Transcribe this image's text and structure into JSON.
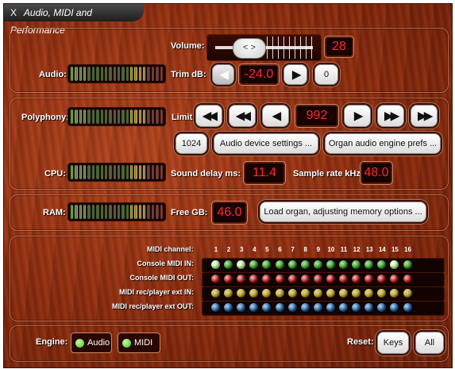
{
  "window": {
    "close_glyph": "X",
    "title": "Audio, MIDI and Performance"
  },
  "audio": {
    "label": "Audio:",
    "volume_label": "Volume:",
    "volume_value": "28",
    "volume_knob_glyph": "< >",
    "trim_label": "Trim dB:",
    "trim_value": "-24.0",
    "trim_reset": "0"
  },
  "polyphony": {
    "label": "Polyphony:",
    "limit_label": "Limit:",
    "limit_value": "992",
    "preset_button": "1024",
    "device_settings_button": "Audio device settings ...",
    "engine_prefs_button": "Organ audio engine prefs ..."
  },
  "cpu": {
    "label": "CPU:",
    "sound_delay_label": "Sound delay ms:",
    "sound_delay_value": "11.4",
    "sample_rate_label": "Sample rate kHz:",
    "sample_rate_value": "48.0"
  },
  "ram": {
    "label": "RAM:",
    "free_label": "Free GB:",
    "free_value": "46.0",
    "load_button": "Load organ, adjusting memory options ..."
  },
  "midi": {
    "channel_label": "MIDI channel:",
    "channels": [
      "1",
      "2",
      "3",
      "4",
      "5",
      "6",
      "7",
      "8",
      "9",
      "10",
      "11",
      "12",
      "13",
      "14",
      "15",
      "16"
    ],
    "rows": [
      {
        "label": "Console MIDI IN:",
        "color": "#33c21c",
        "active": [
          0,
          2,
          14
        ]
      },
      {
        "label": "Console MIDI OUT:",
        "color": "#d11010",
        "active": []
      },
      {
        "label": "MIDI rec/player ext IN:",
        "color": "#e3c20a",
        "active": []
      },
      {
        "label": "MIDI rec/player ext OUT:",
        "color": "#1d78d0",
        "active": []
      }
    ]
  },
  "footer": {
    "engine_label": "Engine:",
    "engine_audio": "Audio",
    "engine_midi": "MIDI",
    "reset_label": "Reset:",
    "reset_keys": "Keys",
    "reset_all": "All"
  },
  "meter_colors": {
    "green": "#7be04a",
    "yellow": "#e8d84a",
    "red": "#d9382c",
    "dark_green": "#2f6b1e",
    "dark_red": "#6b1a12"
  }
}
